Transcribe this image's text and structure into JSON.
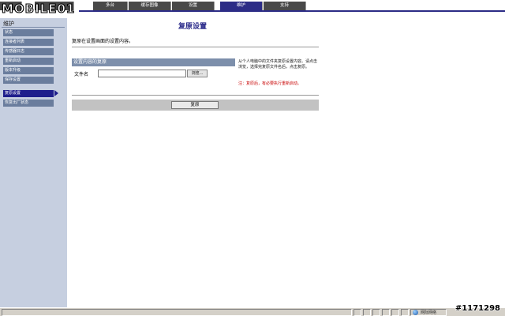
{
  "logo": {
    "text": "MOBILE01"
  },
  "tabs": [
    {
      "label": ""
    },
    {
      "label": ""
    },
    {
      "label": "多台"
    },
    {
      "label": "缓存图像"
    },
    {
      "label": "设置"
    },
    {
      "label": "维护"
    },
    {
      "label": "支持"
    }
  ],
  "sidebar": {
    "title": "维护",
    "items": [
      {
        "label": "状态"
      },
      {
        "label": "连接者列表"
      },
      {
        "label": "传感器日志"
      },
      {
        "label": "重新启动"
      },
      {
        "label": "版本升级"
      },
      {
        "label": "保存设置"
      },
      {
        "label": "复原设置"
      },
      {
        "label": "恢复出厂状态"
      }
    ],
    "active_index": 6
  },
  "main": {
    "title": "复原设置",
    "description": "复原在设置画面的设置内容。",
    "panel_header": "设置内容的复原",
    "file_label": "文件名",
    "file_value": "",
    "browse_label": "浏览...",
    "help_text": "从个人电脑中的文件夹复原设置内容。请点击浏览，选择完复原文件名后，点击复原。",
    "note_text": "注：复原后，有必要执行重新启动。",
    "restore_label": "复原"
  },
  "statusbar": {
    "zone_label": "网际网络"
  },
  "watermark": "#1171298",
  "colors": {
    "tab_bg": "#494949",
    "tab_active": "#2c2c86",
    "sidebar_bg": "#c6cfe0",
    "sidebar_item": "#6a7d9d",
    "sidebar_active": "#1e1e8c",
    "panel_header": "#7d8fab",
    "note": "#c80000"
  }
}
